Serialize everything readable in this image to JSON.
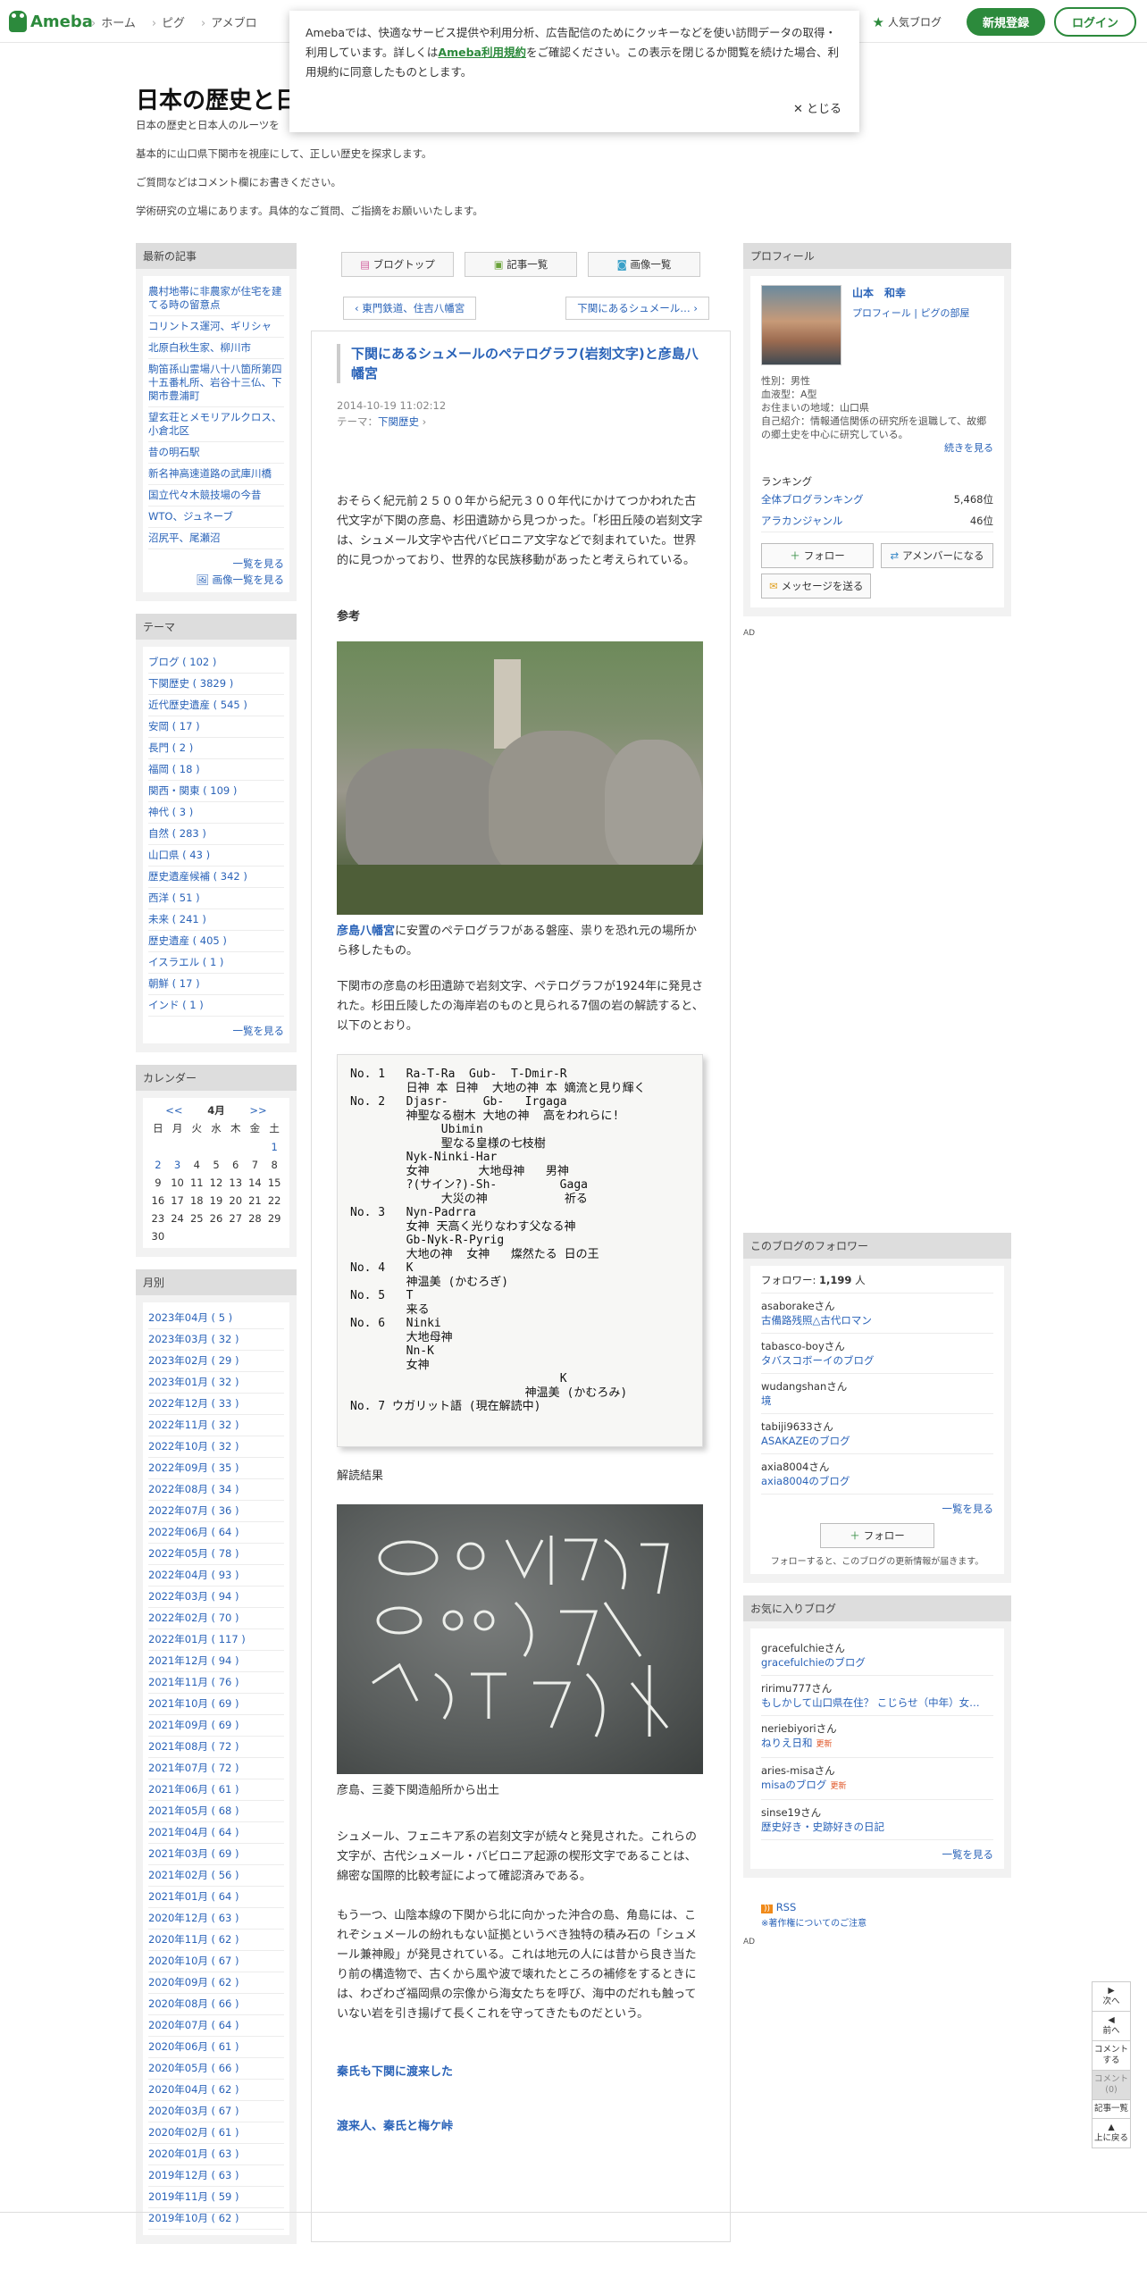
{
  "header": {
    "logo": "Ameba",
    "nav": [
      "ホーム",
      "ピグ",
      "アメブロ"
    ],
    "popular": "人気ブログ",
    "register": "新規登録",
    "login": "ログイン"
  },
  "cookie": {
    "text1": "Amebaでは、快適なサービス提供や利用分析、広告配信のためにクッキーなどを使い訪問データの取得・利用しています。詳しくは",
    "link": "Ameba利用規約",
    "text2": "をご確認ください。この表示を閉じるか閲覧を続けた場合、利用規約に同意したものとします。",
    "close": "とじる"
  },
  "blog": {
    "title": "日本の歴史と日",
    "desc": [
      "日本の歴史と日本人のルーツを",
      "基本的に山口県下関市を視座にして、正しい歴史を探求します。",
      "ご質問などはコメント欄にお書きください。",
      "学術研究の立場にあります。具体的なご質問、ご指摘をお願いいたします。"
    ]
  },
  "latest": {
    "head": "最新の記事",
    "items": [
      "農村地帯に非農家が住宅を建てる時の留意点",
      "コリントス運河、ギリシャ",
      "北原白秋生家、柳川市",
      "駒笛孫山霊場八十八箇所第四十五番札所、岩谷十三仏、下関市豊浦町",
      "望玄荘とメモリアルクロス、小倉北区",
      "昔の明石駅",
      "新名神高速道路の武庫川橋",
      "国立代々木競技場の今昔",
      "WTO、ジュネーブ",
      "沼尻平、尾瀬沼"
    ],
    "more": "一覧を見る",
    "images": "画像一覧を見る"
  },
  "themes": {
    "head": "テーマ",
    "items": [
      "ブログ ( 102 )",
      "下関歴史 ( 3829 )",
      "近代歴史遺産 ( 545 )",
      "安岡 ( 17 )",
      "長門 ( 2 )",
      "福岡 ( 18 )",
      "関西・関東 ( 109 )",
      "神代 ( 3 )",
      "自然 ( 283 )",
      "山口県 ( 43 )",
      "歴史遺産候補 ( 342 )",
      "西洋 ( 51 )",
      "未来 ( 241 )",
      "歴史遺産 ( 405 )",
      "イスラエル ( 1 )",
      "朝鮮 ( 17 )",
      "インド ( 1 )"
    ],
    "more": "一覧を見る"
  },
  "calendar": {
    "head": "カレンダー",
    "prev": "<<",
    "month": "4月",
    "next": ">>",
    "weekdays": [
      "日",
      "月",
      "火",
      "水",
      "木",
      "金",
      "土"
    ],
    "days": [
      "",
      "",
      "",
      "",
      "",
      "",
      "1",
      "2",
      "3",
      "4",
      "5",
      "6",
      "7",
      "8",
      "9",
      "10",
      "11",
      "12",
      "13",
      "14",
      "15",
      "16",
      "17",
      "18",
      "19",
      "20",
      "21",
      "22",
      "23",
      "24",
      "25",
      "26",
      "27",
      "28",
      "29",
      "30"
    ]
  },
  "monthly": {
    "head": "月別",
    "items": [
      "2023年04月 ( 5 )",
      "2023年03月 ( 32 )",
      "2023年02月 ( 29 )",
      "2023年01月 ( 32 )",
      "2022年12月 ( 33 )",
      "2022年11月 ( 32 )",
      "2022年10月 ( 32 )",
      "2022年09月 ( 35 )",
      "2022年08月 ( 34 )",
      "2022年07月 ( 36 )",
      "2022年06月 ( 64 )",
      "2022年05月 ( 78 )",
      "2022年04月 ( 93 )",
      "2022年03月 ( 94 )",
      "2022年02月 ( 70 )",
      "2022年01月 ( 117 )",
      "2021年12月 ( 94 )",
      "2021年11月 ( 76 )",
      "2021年10月 ( 69 )",
      "2021年09月 ( 69 )",
      "2021年08月 ( 72 )",
      "2021年07月 ( 72 )",
      "2021年06月 ( 61 )",
      "2021年05月 ( 68 )",
      "2021年04月 ( 64 )",
      "2021年03月 ( 69 )",
      "2021年02月 ( 56 )",
      "2021年01月 ( 64 )",
      "2020年12月 ( 63 )",
      "2020年11月 ( 62 )",
      "2020年10月 ( 67 )",
      "2020年09月 ( 62 )",
      "2020年08月 ( 66 )",
      "2020年07月 ( 64 )",
      "2020年06月 ( 61 )",
      "2020年05月 ( 66 )",
      "2020年04月 ( 62 )",
      "2020年03月 ( 67 )",
      "2020年02月 ( 61 )",
      "2020年01月 ( 63 )",
      "2019年12月 ( 63 )",
      "2019年11月 ( 59 )",
      "2019年10月 ( 62 )"
    ]
  },
  "center": {
    "buttons": [
      "ブログトップ",
      "記事一覧",
      "画像一覧"
    ],
    "prev": "東門鉄道、住吉八幡宮",
    "next": "下関にあるシュメール…",
    "title": "下関にあるシュメールのペテログラフ(岩刻文字)と彦島八幡宮",
    "date": "2014-10-19 11:02:12",
    "theme_label": "テーマ：",
    "theme": "下関歴史",
    "p1": "おそらく紀元前２５００年から紀元３００年代にかけてつかわれた古代文字が下関の彦島、杉田遺跡から見つかった。「杉田丘陵の岩刻文字は、シュメール文字や古代バビロニア文字などで刻まれていた。世界的に見つかっており、世界的な民族移動があったと考えられている。",
    "ref": "参考",
    "cap1_link": "彦島八幡宮",
    "cap1": "に安置のペテログラフがある磐座、祟りを恐れ元の場所から移したもの。",
    "p2": "下関市の彦島の杉田遺跡で岩刻文字、ペテログラフが1924年に発見された。杉田丘陵したの海岸岩のものと見られる7個の岩の解読すると、以下のとおり。",
    "decode": "解読結果",
    "cap3": "彦島、三菱下関造船所から出土",
    "p3": "シュメール、フェニキア系の岩刻文字が続々と発見された。これらの文字が、古代シュメール・バビロニア起源の楔形文字であることは、綿密な国際的比較考証によって確認済みである。",
    "p4": "もう一つ、山陰本線の下関から北に向かった沖合の島、角島には、これぞシュメールの紛れもない証拠というべき独特の積み石の「シュメール兼神殿」が発見されている。これは地元の人には昔から良き当たり前の構造物で、古くから風や波で壊れたところの補修をするときには、わざわざ福岡県の宗像から海女たちを呼び、海中のだれも触っていない岩を引き揚げて長くこれを守ってきたものだという。",
    "link1": "秦氏も下関に渡来した",
    "link2": "渡来人、秦氏と梅ケ峠",
    "tablet": "No. 1   Ra-T-Ra  Gub-  T-Dmir-R\n        日神 本 日神  大地の神 本 嫡流と見り輝く\nNo. 2   Djasr-     Gb-   Irgaga\n        神聖なる樹木 大地の神  高をわれらに!\n             Ubimin\n             聖なる皇様の七枝樹\n        Nyk-Ninki-Har\n        女神       大地母神   男神\n        ?(サイン?)-Sh-         Gaga\n             大災の神           祈る\nNo. 3   Nyn-Padrra\n        女神 天高く光りなわす父なる神\n        Gb-Nyk-R-Pyrig\n        大地の神  女神   燦然たる 日の王\nNo. 4   K\n        神温美 (かむろぎ)\nNo. 5   T\n        来る\nNo. 6   Ninki\n        大地母神\n        Nn-K\n        女神\n                              K\n                         神温美 (かむろみ)\nNo. 7 ウガリット語 (現在解読中)"
  },
  "profile": {
    "head": "プロフィール",
    "name": "山本　和幸",
    "link1": "プロフィール",
    "link2": "ピグの部屋",
    "info": [
      "性別：男性",
      "血液型：A型",
      "お住まいの地域：山口県",
      "自己紹介：情報通信関係の研究所を退職して、故郷の郷土史を中心に研究している。"
    ],
    "more": "続きを見る",
    "rank_head": "ランキング",
    "rank1_label": "全体ブログランキング",
    "rank1_value": "5,468位",
    "rank2_label": "アラカンジャンル",
    "rank2_value": "46位",
    "follow": "フォロー",
    "amember": "アメンバーになる",
    "message": "メッセージを送る"
  },
  "followers": {
    "head": "このブログのフォロワー",
    "count_label": "フォロワー:",
    "count": "1,199",
    "unit": "人",
    "items": [
      {
        "user": "asaborakeさん",
        "blog": "古備路残照△古代ロマン"
      },
      {
        "user": "tabasco-boyさん",
        "blog": "タバスコボーイのブログ"
      },
      {
        "user": "wudangshanさん",
        "blog": "境"
      },
      {
        "user": "tabiji9633さん",
        "blog": "ASAKAZEのブログ"
      },
      {
        "user": "axia8004さん",
        "blog": "axia8004のブログ"
      }
    ],
    "more": "一覧を見る",
    "follow": "フォロー",
    "note": "フォローすると、このブログの更新情報が届きます。"
  },
  "favorites": {
    "head": "お気に入りブログ",
    "items": [
      {
        "user": "gracefulchieさん",
        "blog": "gracefulchieのブログ",
        "new": ""
      },
      {
        "user": "ririmu777さん",
        "blog": "もしかして山口県在住？ こじらせ（中年）女…",
        "new": ""
      },
      {
        "user": "neriebiyoriさん",
        "blog": "ねりえ日和",
        "new": "更新"
      },
      {
        "user": "aries-misaさん",
        "blog": "misaのブログ",
        "new": "更新"
      },
      {
        "user": "sinse19さん",
        "blog": "歴史好き・史跡好きの日記",
        "new": ""
      }
    ],
    "more": "一覧を見る"
  },
  "misc": {
    "rss": "RSS",
    "copyright": "※著作権についてのご注意",
    "ad1": "AD",
    "ad2": "AD"
  },
  "floatnav": {
    "next": "次へ",
    "prev": "前へ",
    "comment": "コメントする",
    "comments": "コメント(0)",
    "list": "記事一覧",
    "top": "上に戻る"
  }
}
